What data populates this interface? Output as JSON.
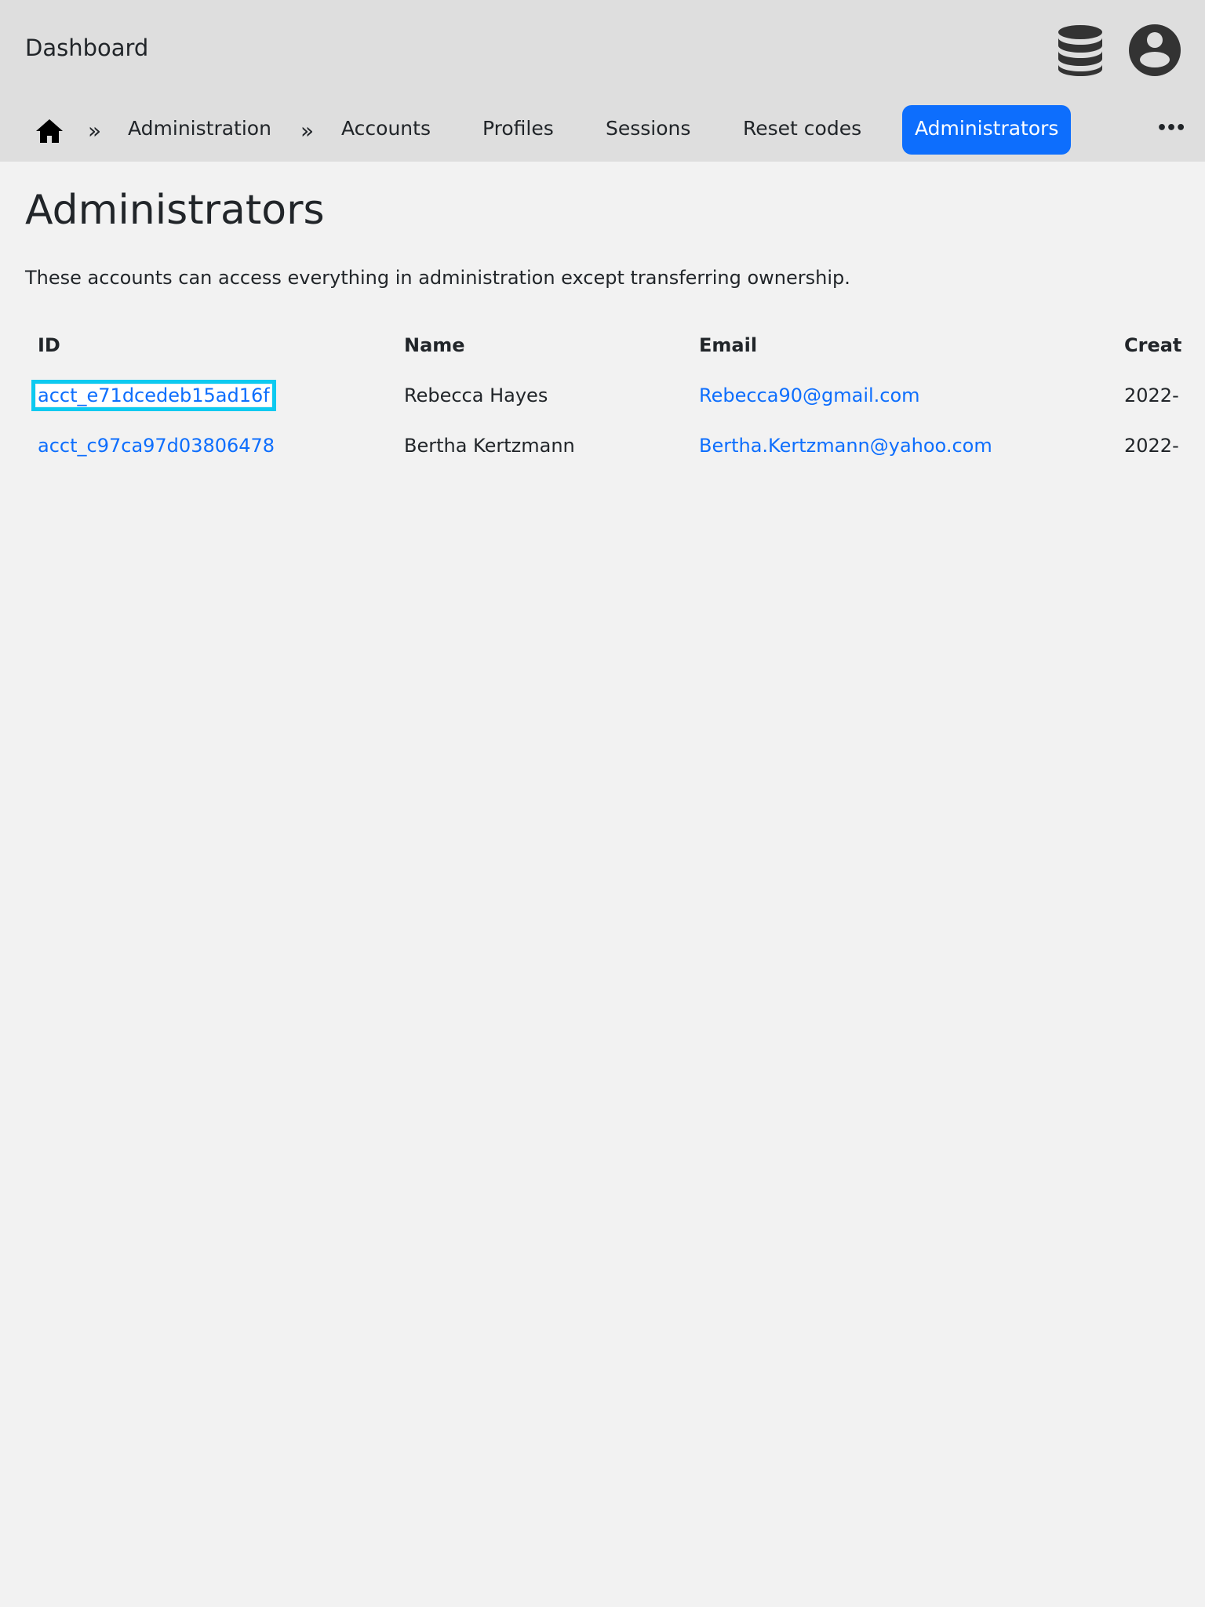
{
  "header": {
    "brand": "Dashboard",
    "icons": [
      "database-icon",
      "user-circle-icon"
    ]
  },
  "nav": {
    "breadcrumb": [
      "Administration"
    ],
    "separator": "»",
    "items": [
      "Accounts",
      "Profiles",
      "Sessions",
      "Reset codes",
      "Administrators"
    ],
    "active": "Administrators",
    "more": "•••"
  },
  "page": {
    "title": "Administrators",
    "description": "These accounts can access everything in administration except transferring ownership."
  },
  "table": {
    "columns": [
      "ID",
      "Name",
      "Email",
      "Created"
    ],
    "rows": [
      {
        "id": "acct_e71dcedeb15ad16f",
        "name": "Rebecca Hayes",
        "email": "Rebecca90@gmail.com",
        "created": "2022-"
      },
      {
        "id": "acct_c97ca97d03806478",
        "name": "Bertha Kertzmann",
        "email": "Bertha.Kertzmann@yahoo.com",
        "created": "2022-"
      }
    ]
  },
  "colors": {
    "accent": "#0d6efd",
    "focus": "#0dcaf0",
    "header_bg": "#dedede",
    "page_bg": "#f2f2f2"
  }
}
